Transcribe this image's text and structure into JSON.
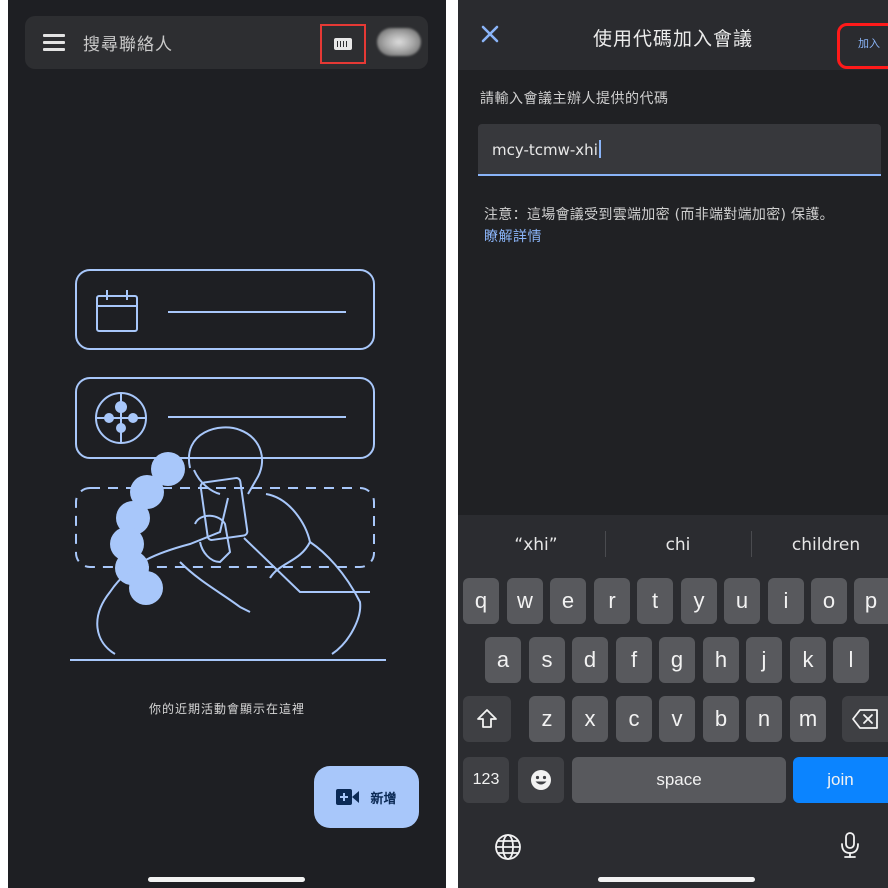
{
  "left_screen": {
    "search": {
      "placeholder": "搜尋聯絡人"
    },
    "icons": {
      "menu": "hamburger-icon",
      "keyboard": "keyboard-icon",
      "avatar": "blurred-avatar"
    },
    "empty_state_text": "你的近期活動會顯示在這裡",
    "fab": {
      "label": "新增",
      "icon": "video-add-icon"
    }
  },
  "right_screen": {
    "title": "使用代碼加入會議",
    "join_action": "加入",
    "prompt": "請輸入會議主辦人提供的代碼",
    "code_input": {
      "value": "mcy-tcmw-xhi"
    },
    "notice": "注意：這場會議受到雲端加密 (而非端對端加密) 保護。",
    "learn_more": "瞭解詳情",
    "keyboard": {
      "suggestions": [
        "“xhi”",
        "chi",
        "children"
      ],
      "row1": [
        "q",
        "w",
        "e",
        "r",
        "t",
        "y",
        "u",
        "i",
        "o",
        "p"
      ],
      "row2": [
        "a",
        "s",
        "d",
        "f",
        "g",
        "h",
        "j",
        "k",
        "l"
      ],
      "row3": [
        "z",
        "x",
        "c",
        "v",
        "b",
        "n",
        "m"
      ],
      "numbers_key": "123",
      "space_key": "space",
      "join_key": "join"
    }
  },
  "colors": {
    "accent": "#8ab4f8",
    "fab": "#a8c7fa",
    "highlight": "#e53935",
    "join_key": "#0b84ff"
  }
}
